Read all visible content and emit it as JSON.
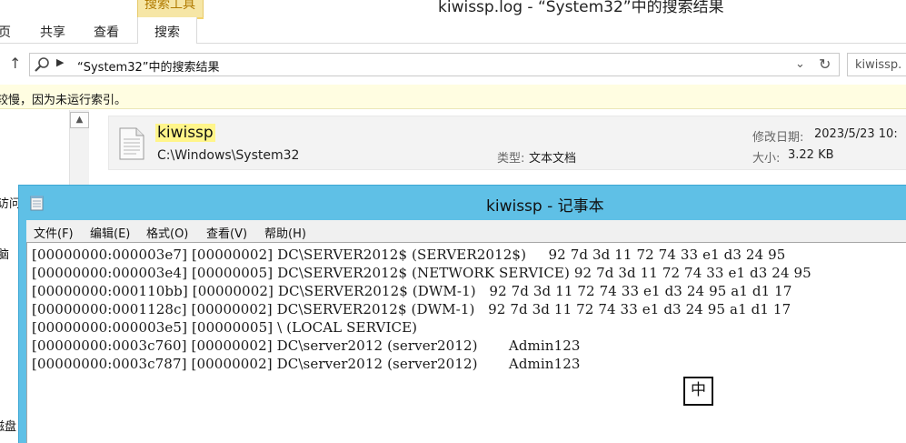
{
  "explorer": {
    "title": "kiwissp.log - “System32”中的搜索结果",
    "context_tab_header": "搜索工具",
    "ribbon_tabs": [
      {
        "label": "页"
      },
      {
        "label": "共享"
      },
      {
        "label": "查看"
      },
      {
        "label": "搜索"
      }
    ],
    "address_path": "“System32”中的搜索结果",
    "search_box_value": "kiwissp.",
    "info_bar_text": "较慢，因为未运行索引。",
    "nav_labels": [
      "访问",
      "脑",
      "磁盘"
    ],
    "result": {
      "name": "kiwissp",
      "path": "C:\\Windows\\System32",
      "type_label": "类型:",
      "type_value": "文本文档",
      "modified_label": "修改日期:",
      "modified_value": "2023/5/23 10:",
      "size_label": "大小:",
      "size_value": "3.22 KB"
    }
  },
  "notepad": {
    "title": "kiwissp - 记事本",
    "menu": [
      {
        "label": "文件(F)"
      },
      {
        "label": "编辑(E)"
      },
      {
        "label": "格式(O)"
      },
      {
        "label": "查看(V)"
      },
      {
        "label": "帮助(H)"
      }
    ],
    "lines": [
      "[00000000:000003e7] [00000002] DC\\SERVER2012$ (SERVER2012$)     92 7d 3d 11 72 74 33 e1 d3 24 95",
      "[00000000:000003e4] [00000005] DC\\SERVER2012$ (NETWORK SERVICE) 92 7d 3d 11 72 74 33 e1 d3 24 95",
      "[00000000:000110bb] [00000002] DC\\SERVER2012$ (DWM-1)   92 7d 3d 11 72 74 33 e1 d3 24 95 a1 d1 17",
      "[00000000:0001128c] [00000002] DC\\SERVER2012$ (DWM-1)   92 7d 3d 11 72 74 33 e1 d3 24 95 a1 d1 17",
      "[00000000:000003e5] [00000005] \\ (LOCAL SERVICE)",
      "[00000000:0003c760] [00000002] DC\\server2012 (server2012)       Admin123",
      "[00000000:0003c787] [00000002] DC\\server2012 (server2012)       Admin123"
    ]
  },
  "ime_indicator": "中"
}
